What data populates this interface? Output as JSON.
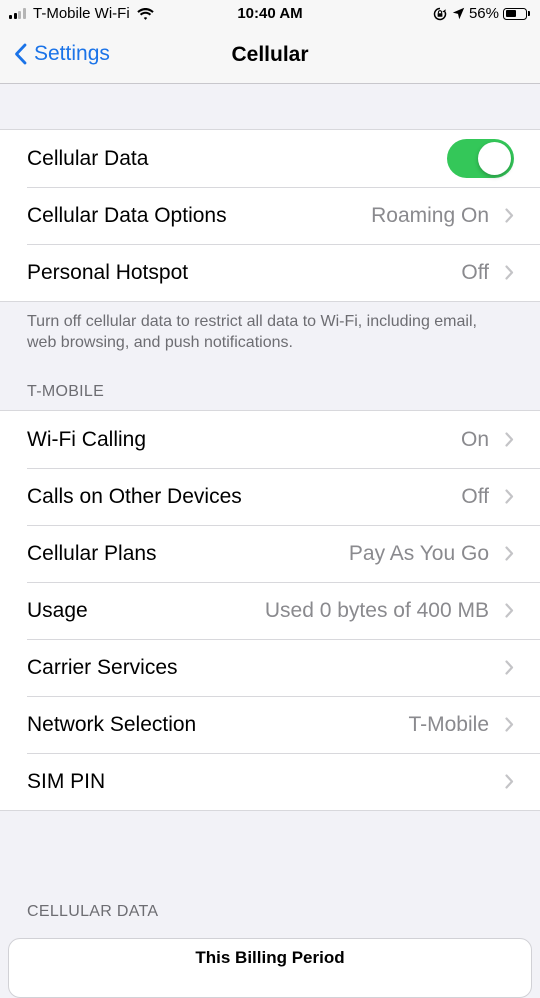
{
  "status_bar": {
    "carrier": "T-Mobile Wi-Fi",
    "time": "10:40 AM",
    "battery_percent": "56%",
    "battery_level": 0.56,
    "icons": [
      "signal-icon",
      "wifi-icon",
      "orientation-lock-icon",
      "location-icon",
      "battery-icon"
    ]
  },
  "nav": {
    "back_label": "Settings",
    "title": "Cellular"
  },
  "group1": {
    "rows": [
      {
        "label": "Cellular Data",
        "toggle_on": true
      },
      {
        "label": "Cellular Data Options",
        "value": "Roaming On"
      },
      {
        "label": "Personal Hotspot",
        "value": "Off"
      }
    ],
    "footer": "Turn off cellular data to restrict all data to Wi-Fi, including email, web browsing, and push notifications."
  },
  "group2": {
    "header": "T-MOBILE",
    "rows": [
      {
        "label": "Wi-Fi Calling",
        "value": "On"
      },
      {
        "label": "Calls on Other Devices",
        "value": "Off"
      },
      {
        "label": "Cellular Plans",
        "value": "Pay As You Go"
      },
      {
        "label": "Usage",
        "value": "Used 0 bytes of 400 MB"
      },
      {
        "label": "Carrier Services",
        "value": ""
      },
      {
        "label": "Network Selection",
        "value": "T-Mobile"
      },
      {
        "label": "SIM PIN",
        "value": ""
      }
    ]
  },
  "cellular_data_section": {
    "header": "CELLULAR DATA",
    "card_title": "This Billing Period"
  },
  "colors": {
    "accent": "#1a73e8",
    "toggle_on": "#34c759",
    "secondary_text": "#8a8a8e",
    "background": "#f2f2f7"
  }
}
